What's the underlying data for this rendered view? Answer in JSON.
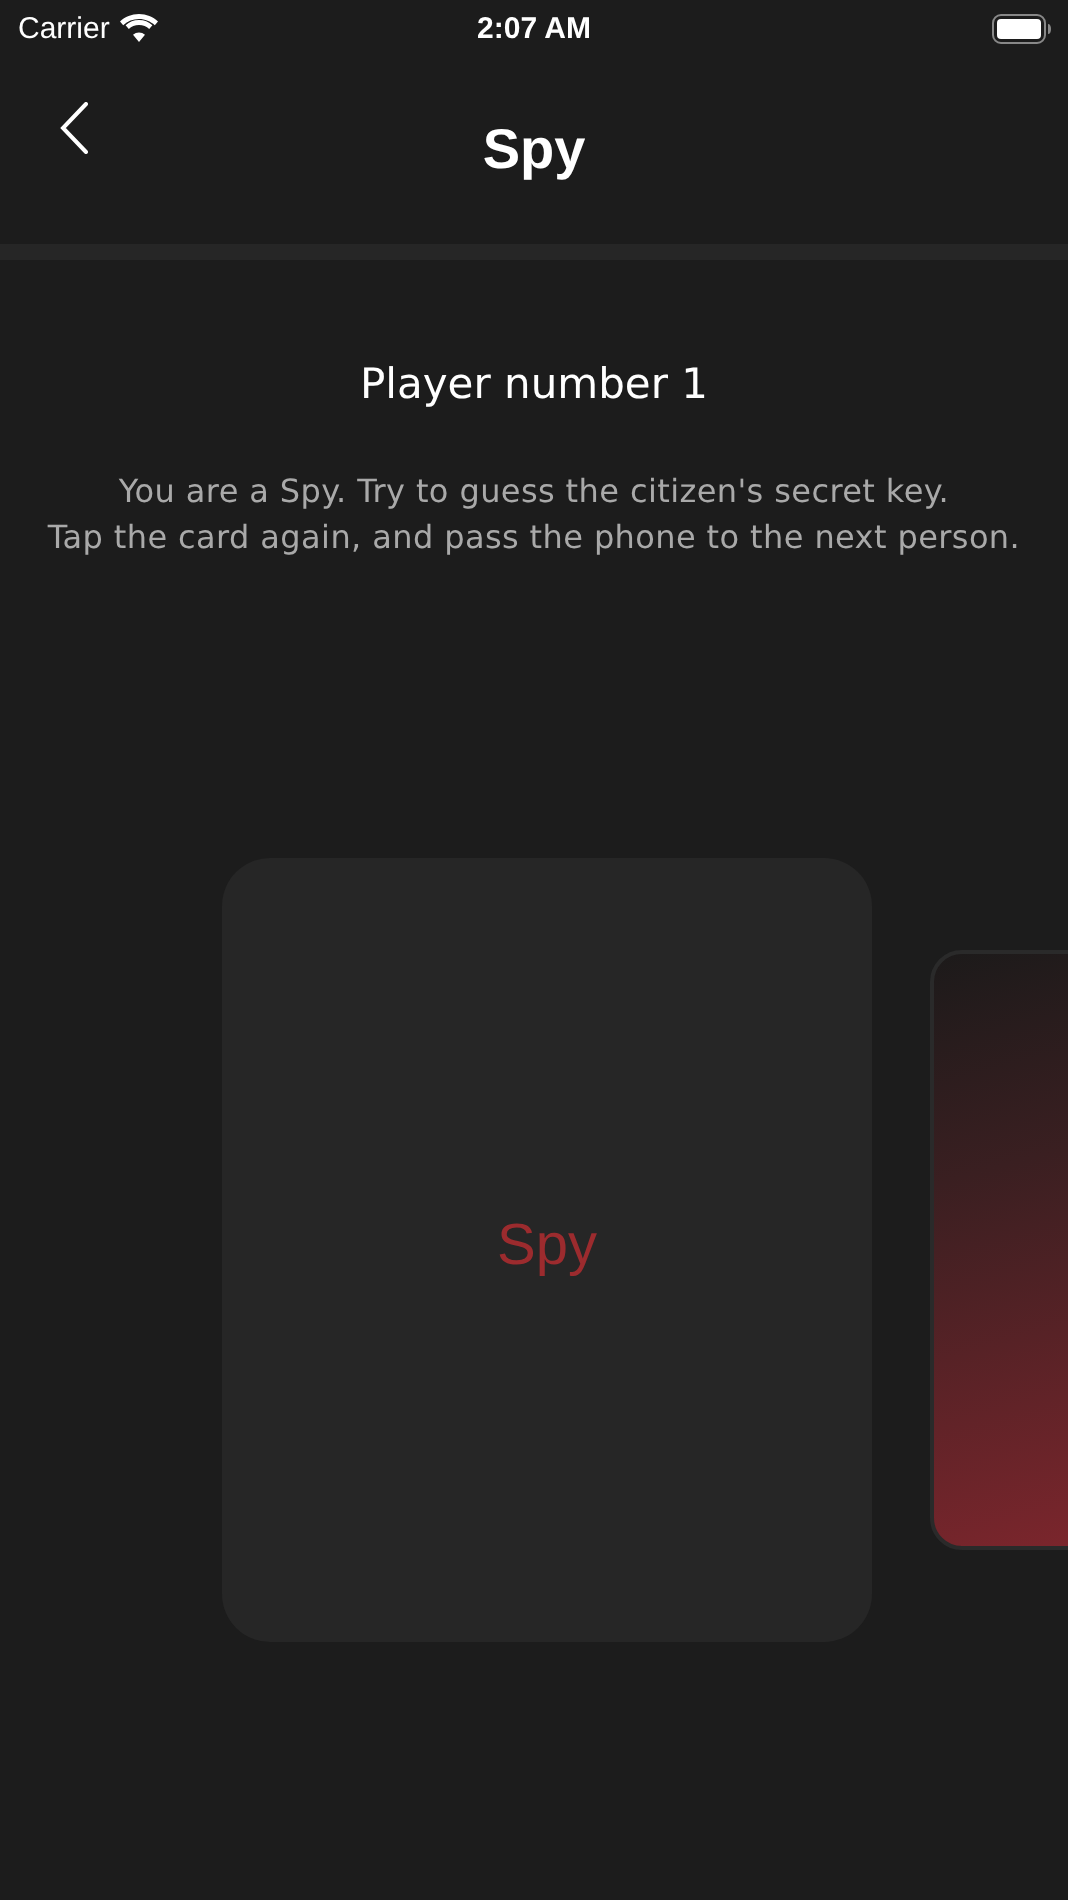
{
  "status_bar": {
    "carrier": "Carrier",
    "time": "2:07 AM"
  },
  "nav": {
    "title": "Spy"
  },
  "player": {
    "title": "Player number 1",
    "description": "You are a Spy. Try to guess the citizen's secret key.\nTap the card again, and pass the phone to the next person."
  },
  "cards": [
    {
      "kind": "revealed",
      "label": "Spy"
    },
    {
      "kind": "hidden"
    }
  ]
}
